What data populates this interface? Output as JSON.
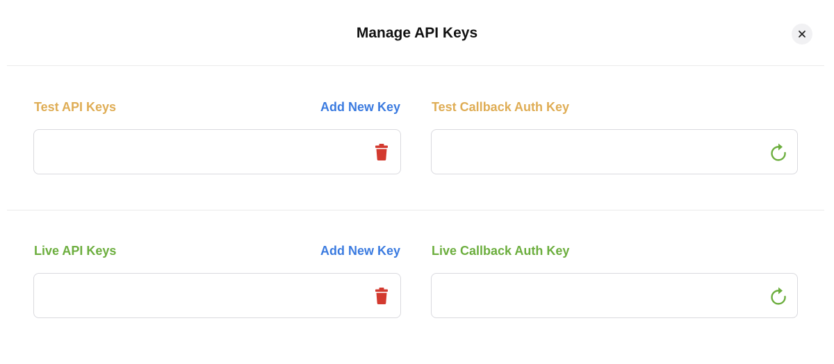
{
  "modal": {
    "title": "Manage API Keys",
    "close_icon": "close-icon"
  },
  "test": {
    "api_keys_label": "Test API Keys",
    "add_new_key_label": "Add New Key",
    "callback_label": "Test Callback Auth Key",
    "api_key_value": "",
    "callback_value": "",
    "label_color": "#dfad55"
  },
  "live": {
    "api_keys_label": "Live API Keys",
    "add_new_key_label": "Add New Key",
    "callback_label": "Live Callback Auth Key",
    "api_key_value": "",
    "callback_value": "",
    "label_color": "#6cae3e"
  },
  "icons": {
    "delete": "trash-icon",
    "regenerate": "refresh-icon"
  },
  "colors": {
    "link": "#3b7be0",
    "delete": "#d33a2f",
    "refresh": "#6cae3e",
    "border": "#d9d9de"
  }
}
